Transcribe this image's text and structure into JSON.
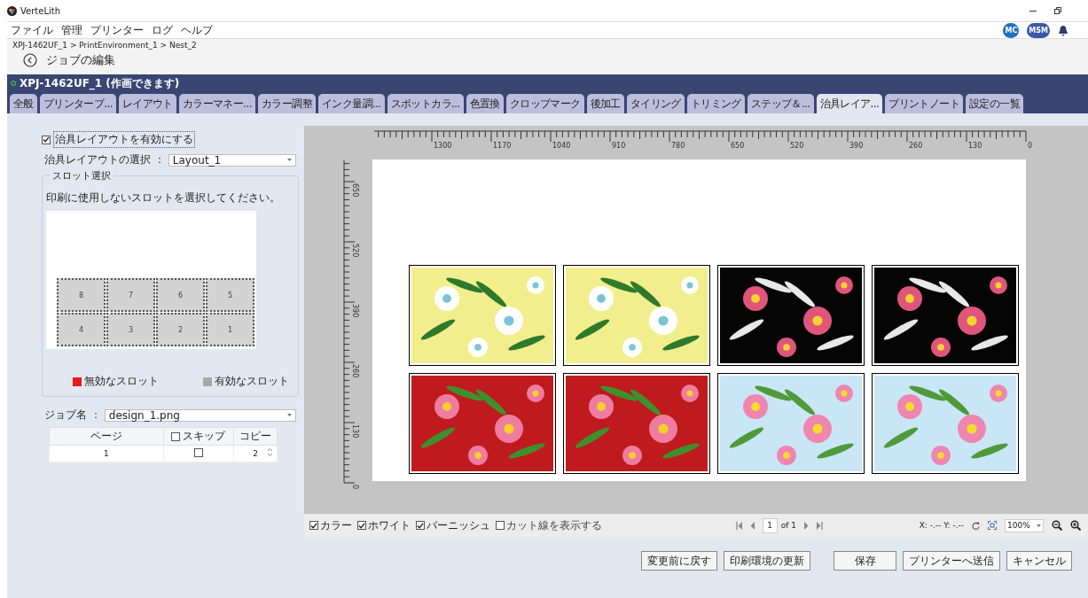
{
  "window": {
    "title": "VerteLith"
  },
  "menu": [
    "ファイル",
    "管理",
    "プリンター",
    "ログ",
    "ヘルプ"
  ],
  "user_badges": [
    "MC",
    "MSM"
  ],
  "breadcrumb": "XPJ-1462UF_1 > PrintEnvironment_1 > Nest_2",
  "page_title": "ジョブの編集",
  "printer_status": "XPJ-1462UF_1 (作画できます)",
  "tabs": [
    {
      "label": "全般",
      "selected": false
    },
    {
      "label": "プリンタープ...",
      "selected": false
    },
    {
      "label": "レイアウト",
      "selected": false
    },
    {
      "label": "カラーマネー...",
      "selected": false
    },
    {
      "label": "カラー調整",
      "selected": false
    },
    {
      "label": "インク量調...",
      "selected": false
    },
    {
      "label": "スポットカラ...",
      "selected": false
    },
    {
      "label": "色置換",
      "selected": false
    },
    {
      "label": "クロップマーク",
      "selected": false
    },
    {
      "label": "後加工",
      "selected": false
    },
    {
      "label": "タイリング",
      "selected": false
    },
    {
      "label": "トリミング",
      "selected": false
    },
    {
      "label": "ステップ＆...",
      "selected": false
    },
    {
      "label": "治具レイア...",
      "selected": true
    },
    {
      "label": "プリントノート",
      "selected": false
    },
    {
      "label": "設定の一覧",
      "selected": false
    }
  ],
  "jig": {
    "enabled_label": "治具レイアウトを有効にする",
    "enabled": true,
    "layout_label": "治具レイアウトの選択 ：",
    "layout_value": "Layout_1",
    "slot_group_title": "スロット選択",
    "instruction": "印刷に使用しないスロットを選択してください。",
    "slots": [
      {
        "label": "8",
        "disabled": false
      },
      {
        "label": "7",
        "disabled": false
      },
      {
        "label": "6",
        "disabled": false
      },
      {
        "label": "5",
        "disabled": false
      },
      {
        "label": "4",
        "disabled": false
      },
      {
        "label": "3",
        "disabled": false
      },
      {
        "label": "2",
        "disabled": false
      },
      {
        "label": "1",
        "disabled": false
      }
    ],
    "legend": [
      {
        "label": "無効なスロット",
        "color": "#e8191b"
      },
      {
        "label": "有効なスロット",
        "color": "#a9a9a9"
      }
    ]
  },
  "job": {
    "label": "ジョブ名 ：",
    "value": "design_1.png",
    "columns": [
      {
        "label": "ページ"
      },
      {
        "label": "スキップ",
        "checked": false
      },
      {
        "label": "コピー"
      }
    ],
    "rows": [
      {
        "page": "1",
        "skip": false,
        "copies": "2"
      }
    ]
  },
  "preview": {
    "x_ruler": [
      "1300",
      "1170",
      "1040",
      "910",
      "780",
      "650",
      "520",
      "390",
      "260",
      "130",
      "0"
    ],
    "y_ruler": [
      "650",
      "520",
      "390",
      "260",
      "130",
      "0"
    ]
  },
  "toolbar": {
    "layers": [
      {
        "label": "カラー",
        "checked": true
      },
      {
        "label": "ホワイト",
        "checked": true
      },
      {
        "label": "バーニッシュ",
        "checked": true
      },
      {
        "label": "カット線を表示する",
        "checked": false
      }
    ],
    "page": "1",
    "page_total": "of 1",
    "coords": "X: -.-- Y: -.--",
    "zoom": "100%"
  },
  "buttons": [
    "変更前に戻す",
    "印刷環境の更新",
    "保存",
    "プリンターへ送信",
    "キャンセル"
  ]
}
